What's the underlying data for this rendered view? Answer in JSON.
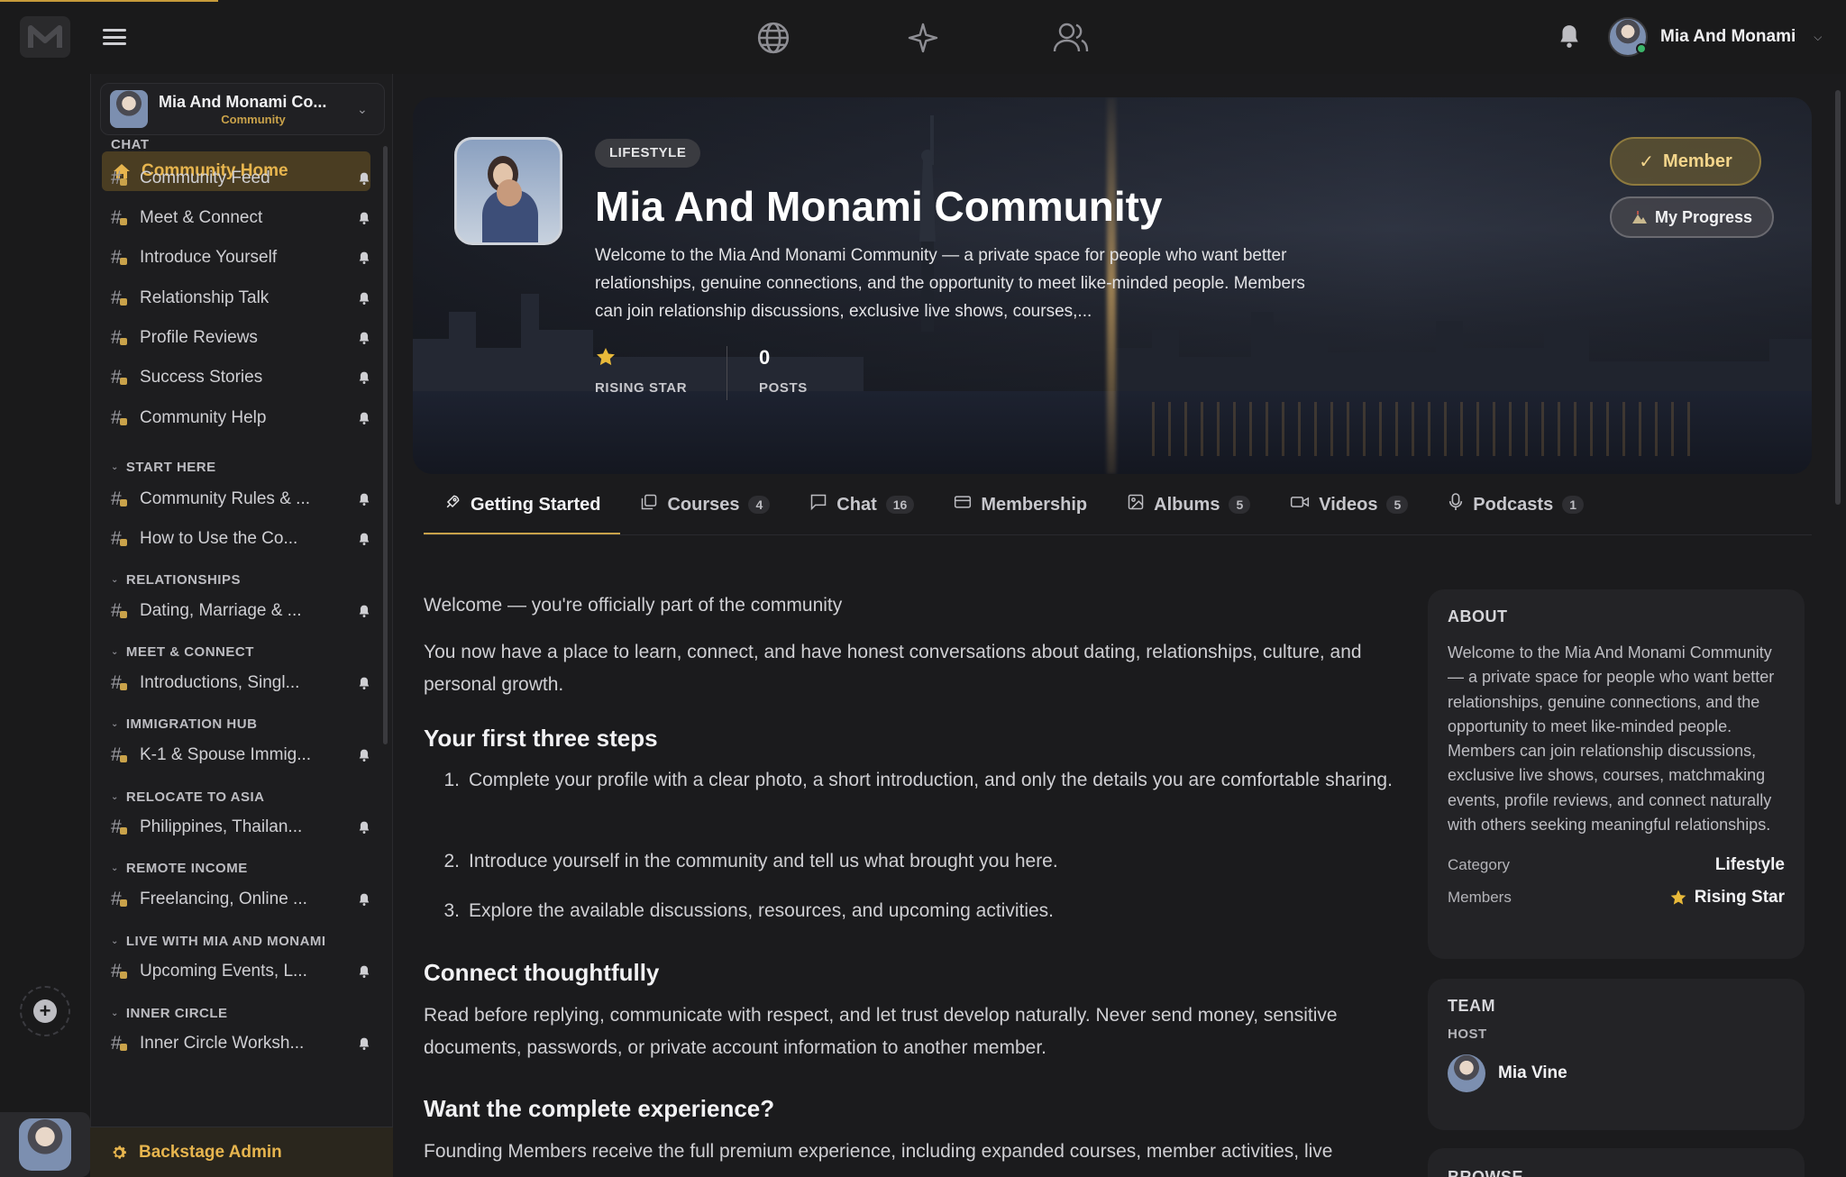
{
  "topbar": {
    "user_name": "Mia And Monami",
    "nav_icons": [
      "globe-icon",
      "sparkle-icon",
      "users-icon"
    ]
  },
  "sidebar": {
    "community_name": "Mia And Monami Co...",
    "community_type": "Community",
    "home_label": "Community Home",
    "sections": [
      {
        "title": "CHAT",
        "collapsible": false,
        "channels": [
          "Community Feed",
          "Meet & Connect",
          "Introduce Yourself",
          "Relationship Talk",
          "Profile Reviews",
          "Success Stories",
          "Community Help"
        ]
      },
      {
        "title": "START HERE",
        "collapsible": true,
        "channels": [
          "Community Rules & ...",
          "How to Use the Co..."
        ]
      },
      {
        "title": "RELATIONSHIPS",
        "collapsible": true,
        "channels": [
          "Dating, Marriage & ..."
        ]
      },
      {
        "title": "MEET & CONNECT",
        "collapsible": true,
        "channels": [
          "Introductions, Singl..."
        ]
      },
      {
        "title": "IMMIGRATION HUB",
        "collapsible": true,
        "channels": [
          "K-1 & Spouse Immig..."
        ]
      },
      {
        "title": "RELOCATE TO ASIA",
        "collapsible": true,
        "channels": [
          "Philippines, Thailan..."
        ]
      },
      {
        "title": "REMOTE INCOME",
        "collapsible": true,
        "channels": [
          "Freelancing, Online ..."
        ]
      },
      {
        "title": "LIVE WITH MIA AND MONAMI",
        "collapsible": true,
        "channels": [
          "Upcoming Events, L..."
        ]
      },
      {
        "title": "INNER CIRCLE",
        "collapsible": true,
        "channels": [
          "Inner Circle Worksh..."
        ]
      }
    ],
    "backstage_label": "Backstage Admin"
  },
  "banner": {
    "tag": "LIFESTYLE",
    "title": "Mia And Monami Community",
    "description": "Welcome to the Mia And Monami Community — a private space for people who want better relationships, genuine connections, and the opportunity to meet like-minded people. Members can join relationship discussions, exclusive live shows, courses,...",
    "stat_rank_label": "RISING STAR",
    "stat_posts_value": "0",
    "stat_posts_label": "POSTS",
    "member_button": "Member",
    "progress_button": "My Progress"
  },
  "tabs": [
    {
      "label": "Getting Started",
      "count": "",
      "icon": "rocket-icon",
      "active": true
    },
    {
      "label": "Courses",
      "count": "4",
      "icon": "courses-icon",
      "active": false
    },
    {
      "label": "Chat",
      "count": "16",
      "icon": "chat-icon",
      "active": false
    },
    {
      "label": "Membership",
      "count": "",
      "icon": "card-icon",
      "active": false
    },
    {
      "label": "Albums",
      "count": "5",
      "icon": "image-icon",
      "active": false
    },
    {
      "label": "Videos",
      "count": "5",
      "icon": "video-icon",
      "active": false
    },
    {
      "label": "Podcasts",
      "count": "1",
      "icon": "mic-icon",
      "active": false
    }
  ],
  "content": {
    "intro": "Welcome — you're officially part of the community",
    "intro_body": "You now have a place to learn, connect, and have honest conversations about dating, relationships, culture, and personal growth.",
    "steps_heading": "Your first three steps",
    "steps": [
      "Complete your profile with a clear photo, a short introduction, and only the details you are comfortable sharing.",
      "Introduce yourself in the community and tell us what brought you here.",
      "Explore the available discussions, resources, and upcoming activities."
    ],
    "connect_heading": "Connect thoughtfully",
    "connect_body": "Read before replying, communicate with respect, and let trust develop naturally. Never send money, sensitive documents, passwords, or private account information to another member.",
    "experience_heading": "Want the complete experience?",
    "experience_body": "Founding Members receive the full premium experience, including expanded courses, member activities, live"
  },
  "about": {
    "title": "ABOUT",
    "body": "Welcome to the Mia And Monami Community — a private space for people who want better relationships, genuine connections, and the opportunity to meet like-minded people. Members can join relationship discussions, exclusive live shows, courses, matchmaking events, profile reviews, and connect naturally with others seeking meaningful relationships.",
    "category_label": "Category",
    "category_value": "Lifestyle",
    "members_label": "Members",
    "members_value": "Rising Star"
  },
  "team": {
    "title": "TEAM",
    "host_label": "HOST",
    "host_name": "Mia Vine"
  },
  "browse": {
    "title": "BROWSE"
  },
  "colors": {
    "accent": "#c9a24a",
    "background": "#1b1b1d",
    "sidebar": "#1d1d1f"
  }
}
